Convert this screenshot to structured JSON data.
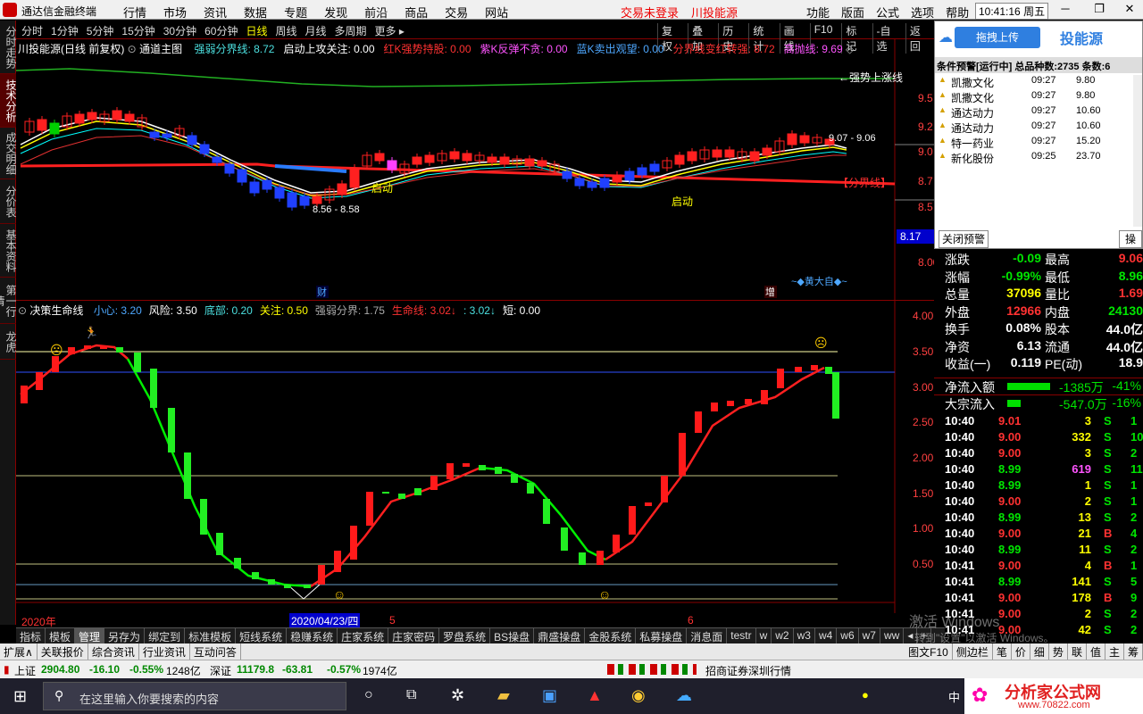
{
  "title": {
    "app": "通达信金融终端",
    "menus": [
      "行情",
      "市场",
      "资讯",
      "数据",
      "专题",
      "发现",
      "前沿",
      "商品",
      "交易",
      "网站"
    ],
    "login_warn": "交易未登录",
    "brand": "川投能源",
    "right_menus": [
      "功能",
      "版面",
      "公式",
      "选项",
      "帮助"
    ],
    "clock": "10:41:16",
    "weekday": "周五",
    "min": "─",
    "restore": "❐",
    "close": "✕"
  },
  "left_tabs": [
    "分时走势",
    "技术分析",
    "成交明细",
    "分价表",
    "基本资料",
    "第一行情",
    "龙虎"
  ],
  "toolbar": {
    "periods": [
      "分时",
      "1分钟",
      "5分钟",
      "15分钟",
      "30分钟",
      "60分钟",
      "日线",
      "周线",
      "月线",
      "多周期",
      "更多 ▸"
    ],
    "selected_period": "日线",
    "tools": [
      "复权",
      "叠加",
      "历史",
      "统计",
      "画线",
      "F10",
      "标记",
      "-自选",
      "返回"
    ]
  },
  "main": {
    "stock": "川投能源(日线 前复权)",
    "template": "通道主图",
    "indicator_items": [
      {
        "t": "强弱分界线: 8.72",
        "c": "cyan"
      },
      {
        "t": "启动上攻关注: 0.00",
        "c": "white"
      },
      {
        "t": "红K强势持股: 0.00",
        "c": "red"
      },
      {
        "t": "紫K反弹不贪: 0.00",
        "c": "pink"
      },
      {
        "t": "蓝K卖出观望: 0.00",
        "c": "blue"
      },
      {
        "t": "分界线变红转强: 8.72",
        "c": "red"
      },
      {
        "t": "高抛线: 9.69",
        "c": "pink"
      }
    ],
    "y_axis": [
      "9.5",
      "9.2",
      "9.0",
      "8.7",
      "8.5",
      "8.00"
    ],
    "current_price": "8.17",
    "labels": {
      "strong": "←强势上涨线",
      "hi_range": "9.07 - 9.06",
      "lo_range": "8.56 - 8.58",
      "qidong1": "启动",
      "qidong2": "启动",
      "fenjie": "【分界线】",
      "cai": "财",
      "zeng": "增",
      "special": "~◆黄大自◆~"
    }
  },
  "sub": {
    "name": "决策生命线",
    "items": [
      {
        "t": "小心: 3.20",
        "c": "blue"
      },
      {
        "t": "风险: 3.50",
        "c": "white"
      },
      {
        "t": "底部: 0.20",
        "c": "cyan"
      },
      {
        "t": "关注: 0.50",
        "c": "yellow"
      },
      {
        "t": "强弱分界: 1.75",
        "c": "gray"
      },
      {
        "t": "生命线: 3.02↓",
        "c": "red"
      },
      {
        "t": ": 3.02↓",
        "c": "cyan"
      },
      {
        "t": "短: 0.00",
        "c": "white"
      }
    ],
    "y_axis": [
      "4.00",
      "3.50",
      "3.00",
      "2.50",
      "2.00",
      "1.50",
      "1.00",
      "0.50"
    ],
    "x_labels": {
      "year": "2020年",
      "date": "2020/04/23/四",
      "m5": "5",
      "m6": "6"
    }
  },
  "bottom_tabs": [
    "指标",
    "模板",
    "管理",
    "另存为",
    "绑定到",
    "标准模板",
    "短线系统",
    "稳赚系统",
    "庄家系统",
    "庄家密码",
    "罗盘系统",
    "BS操盘",
    "鼎盛操盘",
    "金股系统",
    "私募操盘",
    "消息面",
    "testr",
    "w",
    "w2",
    "w3",
    "w4",
    "w6",
    "w7",
    "ww",
    "◂",
    "+"
  ],
  "second_row": [
    "扩展∧",
    "关联报价",
    "综合资讯",
    "行业资讯",
    "互动问答"
  ],
  "second_row_right": [
    "图文F10",
    "侧边栏",
    "笔",
    "价",
    "细",
    "势",
    "联",
    "值",
    "主",
    "筹"
  ],
  "status": {
    "sh_name": "上证",
    "sh_val": "2904.80",
    "sh_chg": "-16.10",
    "sh_pct": "-0.55%",
    "sh_amt": "1248亿",
    "sz_name": "深证",
    "sz_val": "11179.8",
    "sz_chg": "-63.81",
    "sz_pct": "-0.57%",
    "sz_amt": "1974亿",
    "broker": "招商证券深圳行情"
  },
  "taskbar": {
    "search": "在这里输入你要搜索的内容",
    "watermark": "分析家公式网",
    "watermark_url": "www.70822.com",
    "lang": "中",
    "activate": "激活 Windows",
    "activate_sub": "转到\"设置\"以激活 Windows。"
  },
  "popup": {
    "brand": "投能源",
    "header": "条件预警[运行中] 总品种数:2735 条数:6",
    "rows": [
      {
        "n": "凯撒文化",
        "t": "09:27",
        "p": "9.80"
      },
      {
        "n": "凯撒文化",
        "t": "09:27",
        "p": "9.80"
      },
      {
        "n": "通达动力",
        "t": "09:27",
        "p": "10.60"
      },
      {
        "n": "通达动力",
        "t": "09:27",
        "p": "10.60"
      },
      {
        "n": "特一药业",
        "t": "09:27",
        "p": "15.20"
      },
      {
        "n": "新化股份",
        "t": "09:25",
        "p": "23.70"
      }
    ],
    "close_btn": "关闭预警",
    "op_btn": "操",
    "upload": "拖拽上传"
  },
  "quote": [
    {
      "l": "涨跌",
      "v": "-0.09",
      "c": "green",
      "l2": "最高",
      "v2": "9.06",
      "c2": "red"
    },
    {
      "l": "涨幅",
      "v": "-0.99%",
      "c": "green",
      "l2": "最低",
      "v2": "8.96",
      "c2": "green"
    },
    {
      "l": "总量",
      "v": "37096",
      "c": "yellow",
      "l2": "量比",
      "v2": "1.69",
      "c2": "red"
    },
    {
      "l": "外盘",
      "v": "12966",
      "c": "red",
      "l2": "内盘",
      "v2": "24130",
      "c2": "green"
    },
    {
      "l": "换手",
      "v": "0.08%",
      "c": "white",
      "l2": "股本",
      "v2": "44.0亿",
      "c2": "white"
    },
    {
      "l": "净资",
      "v": "6.13",
      "c": "white",
      "l2": "流通",
      "v2": "44.0亿",
      "c2": "white"
    },
    {
      "l": "收益(一)",
      "v": "0.119",
      "c": "white",
      "l2": "PE(动)",
      "v2": "18.9",
      "c2": "white"
    }
  ],
  "flow": [
    {
      "l": "净流入额",
      "v": "-1385万",
      "p": "-41%",
      "bar": 0.8
    },
    {
      "l": "大宗流入",
      "v": "-547.0万",
      "p": "-16%",
      "bar": 0.25
    }
  ],
  "ticks": [
    {
      "t": "10:40",
      "p": "9.01",
      "v": "3",
      "s": "S",
      "n": "1"
    },
    {
      "t": "10:40",
      "p": "9.00",
      "v": "332",
      "s": "S",
      "n": "10"
    },
    {
      "t": "10:40",
      "p": "9.00",
      "v": "3",
      "s": "S",
      "n": "2"
    },
    {
      "t": "10:40",
      "p": "8.99",
      "v": "619",
      "s": "S",
      "n": "11"
    },
    {
      "t": "10:40",
      "p": "8.99",
      "v": "1",
      "s": "S",
      "n": "1"
    },
    {
      "t": "10:40",
      "p": "9.00",
      "v": "2",
      "s": "S",
      "n": "1"
    },
    {
      "t": "10:40",
      "p": "8.99",
      "v": "13",
      "s": "S",
      "n": "2"
    },
    {
      "t": "10:40",
      "p": "9.00",
      "v": "21",
      "s": "B",
      "n": "4"
    },
    {
      "t": "10:40",
      "p": "8.99",
      "v": "11",
      "s": "S",
      "n": "2"
    },
    {
      "t": "10:41",
      "p": "9.00",
      "v": "4",
      "s": "B",
      "n": "1"
    },
    {
      "t": "10:41",
      "p": "8.99",
      "v": "141",
      "s": "S",
      "n": "5"
    },
    {
      "t": "10:41",
      "p": "9.00",
      "v": "178",
      "s": "B",
      "n": "9"
    },
    {
      "t": "10:41",
      "p": "9.00",
      "v": "2",
      "s": "S",
      "n": "2"
    },
    {
      "t": "10:41",
      "p": "9.00",
      "v": "42",
      "s": "S",
      "n": "2"
    }
  ]
}
